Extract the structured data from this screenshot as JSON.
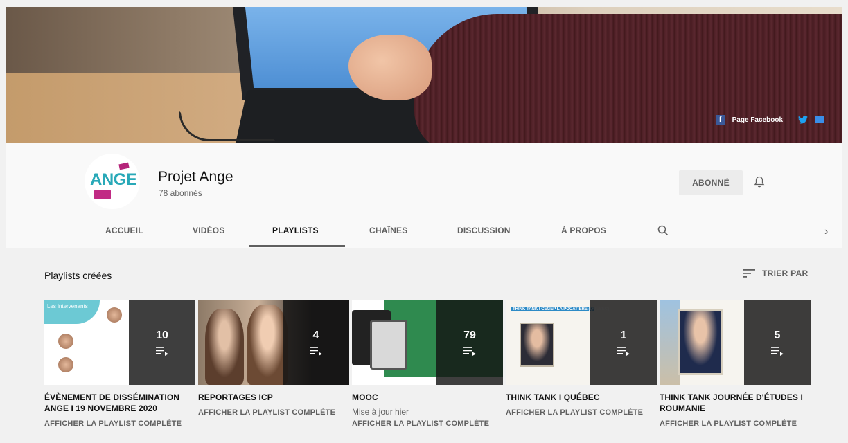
{
  "banner": {
    "facebook_label": "Page Facebook",
    "icons": [
      "facebook-icon",
      "twitter-icon",
      "mail-icon"
    ]
  },
  "channel": {
    "logo_text": "ANGE",
    "name": "Projet Ange",
    "subscribers": "78 abonnés",
    "subscribe_label": "ABONNÉ"
  },
  "tabs": [
    {
      "label": "ACCUEIL",
      "active": false
    },
    {
      "label": "VIDÉOS",
      "active": false
    },
    {
      "label": "PLAYLISTS",
      "active": true
    },
    {
      "label": "CHAÎNES",
      "active": false
    },
    {
      "label": "DISCUSSION",
      "active": false
    },
    {
      "label": "À PROPOS",
      "active": false
    }
  ],
  "section": {
    "title": "Playlists créées",
    "sort_label": "TRIER PAR"
  },
  "playlists": [
    {
      "count": "10",
      "title": "ÉVÈNEMENT DE DISSÉMINATION ANGE I 19 NOVEMBRE 2020",
      "meta": "",
      "link": "AFFICHER LA PLAYLIST COMPLÈTE",
      "thumb_text": "Les intervenants"
    },
    {
      "count": "4",
      "title": "REPORTAGES ICP",
      "meta": "",
      "link": "AFFICHER LA PLAYLIST COMPLÈTE"
    },
    {
      "count": "79",
      "title": "MOOC",
      "meta": "Mise à jour hier",
      "link": "AFFICHER LA PLAYLIST COMPLÈTE"
    },
    {
      "count": "1",
      "title": "THINK TANK I QUÉBEC",
      "meta": "",
      "link": "AFFICHER LA PLAYLIST COMPLÈTE",
      "thumb_text": "THINK TANK I CEGEP LA POCATIÈRE (QUÉBEC)"
    },
    {
      "count": "5",
      "title": "THINK TANK JOURNÉE D'ÉTUDES I ROUMANIE",
      "meta": "",
      "link": "AFFICHER LA PLAYLIST COMPLÈTE"
    }
  ],
  "colors": {
    "accent_teal": "#29a9b8",
    "accent_magenta": "#c12a84",
    "facebook": "#3b5998",
    "twitter": "#1da1f2"
  }
}
